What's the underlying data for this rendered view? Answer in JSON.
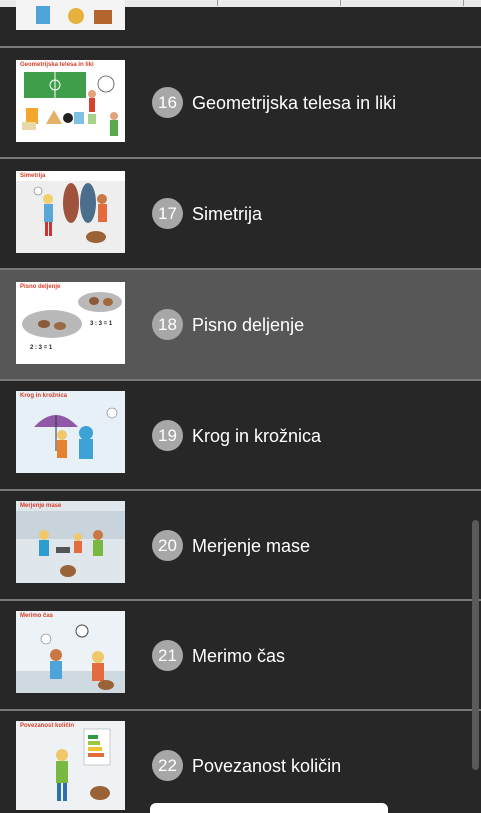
{
  "lessons": [
    {
      "number": "16",
      "title": "Geometrijska telesa in liki",
      "thumb_title": "Geometrijska telesa in liki",
      "active": false
    },
    {
      "number": "17",
      "title": "Simetrija",
      "thumb_title": "Simetrija",
      "active": false
    },
    {
      "number": "18",
      "title": "Pisno deljenje",
      "thumb_title": "Pisno deljenje",
      "active": true
    },
    {
      "number": "19",
      "title": "Krog in krožnica",
      "thumb_title": "Krog in krožnica",
      "active": false
    },
    {
      "number": "20",
      "title": "Merjenje mase",
      "thumb_title": "Merjenje mase",
      "active": false
    },
    {
      "number": "21",
      "title": "Merimo čas",
      "thumb_title": "Merimo čas",
      "active": false
    },
    {
      "number": "22",
      "title": "Povezanost količin",
      "thumb_title": "Povezanost količin",
      "active": false
    }
  ],
  "thumb_texts": {
    "division_a": "3 : 3 = 1",
    "division_b": "2 : 3 = 1"
  },
  "colors": {
    "background": "#262626",
    "active_row": "#575757",
    "badge": "#a7a7a7",
    "separator": "#7a7a7a",
    "thumb_title": "#d8402a"
  }
}
